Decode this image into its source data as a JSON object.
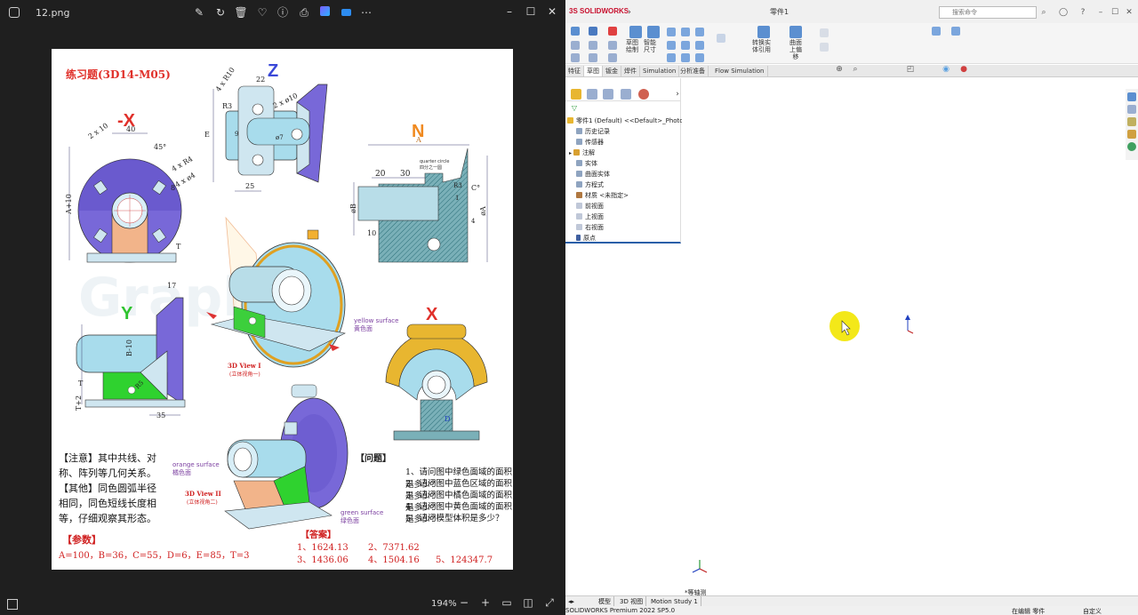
{
  "viewer": {
    "filename": "12.png",
    "zoom": "194%",
    "toolbar_icons": [
      "edit-icon",
      "rotate-icon",
      "delete-icon",
      "favorite-icon",
      "info-icon",
      "print-icon",
      "editor-icon",
      "share-icon",
      "more-icon"
    ]
  },
  "drawing": {
    "title": "练习题(3D14-M05)",
    "views": {
      "neg_x": "-X",
      "z": "Z",
      "n": "N",
      "y": "Y",
      "x": "X"
    },
    "dims": {
      "d2x10": "2 x 10",
      "d40": "40",
      "d45": "45°",
      "d4xR4": "4 x R4",
      "d4xphi4": "4 x ø4",
      "d8": "8",
      "dA10": "A+10",
      "dT": "T",
      "d4xR10": "4 x R10",
      "d22": "22",
      "dR3": "R3",
      "d2xphi10": "2 x ø10",
      "dE": "E",
      "d9": "9",
      "dphi7": "ø7",
      "d25": "25",
      "dA": "A",
      "d20": "20",
      "d30": "30",
      "dphiB": "øB",
      "d10": "10",
      "dC": "C°",
      "dphiA": "øA",
      "d1": "1",
      "d4": "4",
      "dR3b": "R3",
      "d17": "17",
      "dB10": "B-10",
      "dR5": "R5",
      "dT2": "T",
      "dTplus2": "T+2",
      "d35": "35",
      "dD": "D"
    },
    "annotations": {
      "yellow": "yellow surface\n黄色面",
      "orange": "orange surface\n橘色面",
      "green": "green surface\n绿色面",
      "view1": "3D View I",
      "view1_sub": "(立体视角一)",
      "view2": "3D View II",
      "view2_sub": "(立体视角二)",
      "quarter": "quarter circle\n四分之一圆"
    },
    "notes": [
      "【注意】其中共线、对",
      "称、阵列等几何关系。",
      "【其他】同色圆弧半径",
      "相同，同色短线长度相",
      "等，仔细观察其形态。"
    ],
    "params_title": "【参数】",
    "params": "A=100，B=36，C=55，D=6，E=85，T=3",
    "questions_title": "【问题】",
    "questions": [
      "1、请问图中绿色面域的面积是多少？",
      "2、请问图中蓝色区域的面积是多少？",
      "3、请问图中橘色面域的面积是多少？",
      "4、请问图中黄色面域的面积是多少？",
      "5、请问模型体积是多少？"
    ],
    "answers_title": "【答案】",
    "answers": [
      "1、1624.13",
      "2、7371.62",
      "3、1436.06",
      "4、1504.16",
      "5、124347.7"
    ]
  },
  "sw": {
    "logo": "3S SOLIDWORKS",
    "doc_title": "零件1",
    "search_placeholder": "搜索命令",
    "ribbon": {
      "sketch": "草图\n绘制",
      "smart_dim": "智能\n尺寸",
      "convert": "转换实\n体引用",
      "offset": "曲面\n上偏\n移"
    },
    "cmd_tabs": [
      "特征",
      "草图",
      "钣金",
      "焊件",
      "Simulation",
      "分析准备",
      "Flow Simulation"
    ],
    "tree": [
      "零件1 (Default) <<Default>_Photo\\",
      "历史记录",
      "传感器",
      "注解",
      "实体",
      "曲面实体",
      "方程式",
      "材质 <未指定>",
      "前视面",
      "上视面",
      "右视面",
      "原点"
    ],
    "view_label": "*等轴测",
    "bottom_tabs": [
      "模型",
      "3D 视图",
      "Motion Study 1"
    ],
    "status_left": "SOLIDWORKS Premium 2022 SP5.0",
    "status_mid": "在编辑 零件",
    "status_right": "自定义",
    "colors": {
      "brand": "#c8102e",
      "selected_tab": "#2a5fa8",
      "cursor_highlight": "#f2e600"
    }
  }
}
